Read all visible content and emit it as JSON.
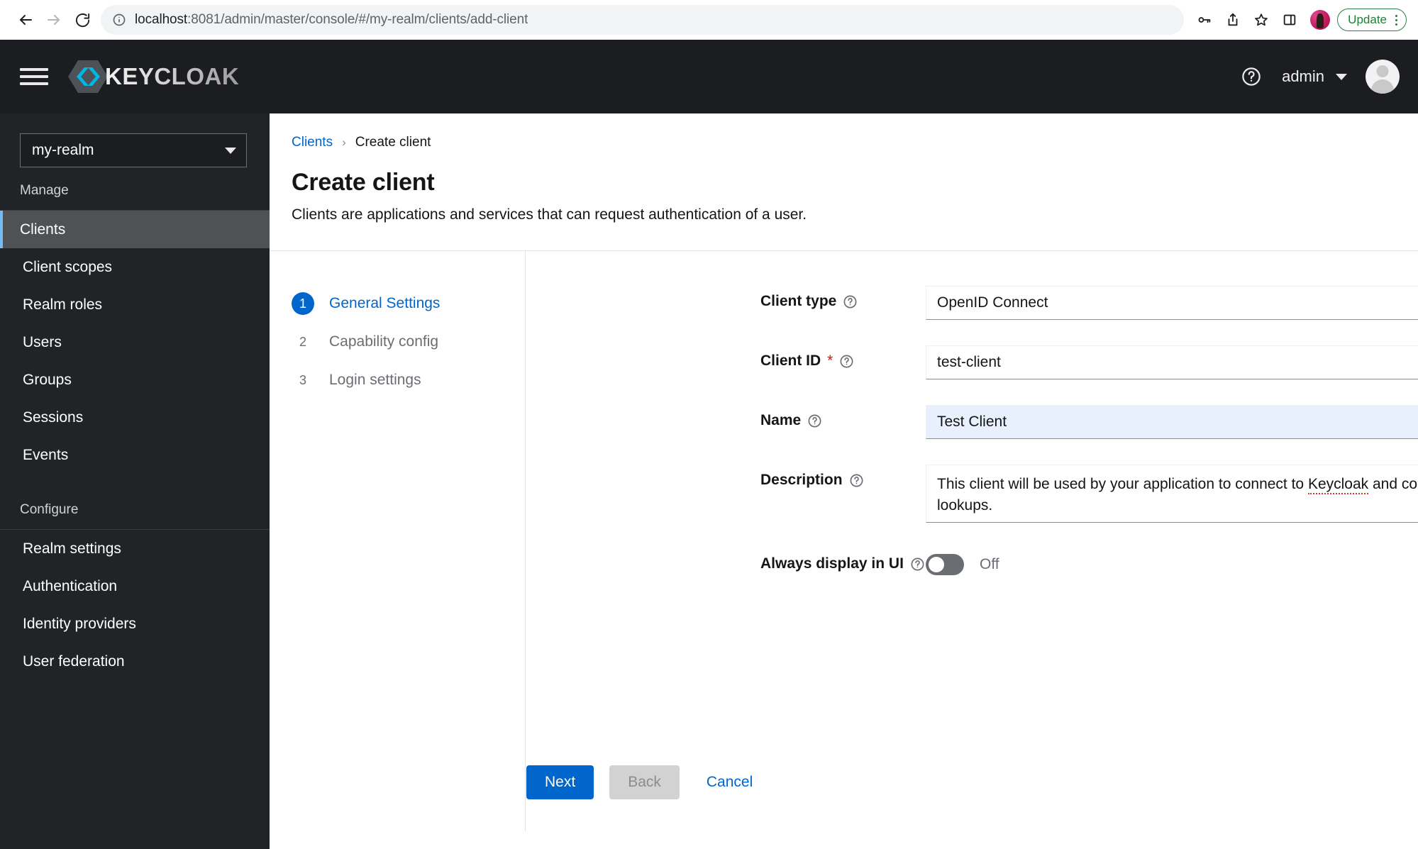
{
  "browser": {
    "back_icon": "back-arrow-icon",
    "forward_icon": "forward-arrow-icon",
    "reload_icon": "reload-icon",
    "info_icon": "site-info-icon",
    "url_host": "localhost",
    "url_path": ":8081/admin/master/console/#/my-realm/clients/add-client",
    "url_full": "localhost:8081/admin/master/console/#/my-realm/clients/add-client",
    "toolbar_icons": [
      "key-icon",
      "share-icon",
      "bookmark-star-icon",
      "side-panel-icon"
    ],
    "profile_avatar": "chrome-profile-avatar",
    "update_label": "Update",
    "menu_icon": "kebab-menu-icon"
  },
  "masthead": {
    "menu_icon": "hamburger-menu-icon",
    "logo_mark": "keycloak-hexagon-logo-icon",
    "logo_text": "KEYCLOAK",
    "help_icon": "help-question-icon",
    "user_name": "admin",
    "user_caret": "chevron-down-icon",
    "avatar": "user-avatar"
  },
  "sidebar": {
    "realm": {
      "value": "my-realm",
      "caret": "chevron-down-icon"
    },
    "sections": [
      {
        "title": "Manage",
        "items": [
          {
            "label": "Clients",
            "active": true
          },
          {
            "label": "Client scopes",
            "active": false
          },
          {
            "label": "Realm roles",
            "active": false
          },
          {
            "label": "Users",
            "active": false
          },
          {
            "label": "Groups",
            "active": false
          },
          {
            "label": "Sessions",
            "active": false
          },
          {
            "label": "Events",
            "active": false
          }
        ]
      },
      {
        "title": "Configure",
        "items": [
          {
            "label": "Realm settings",
            "active": false
          },
          {
            "label": "Authentication",
            "active": false
          },
          {
            "label": "Identity providers",
            "active": false
          },
          {
            "label": "User federation",
            "active": false
          }
        ]
      }
    ]
  },
  "page": {
    "breadcrumb": {
      "parent": "Clients",
      "separator": "›",
      "current": "Create client"
    },
    "title": "Create client",
    "subtitle": "Clients are applications and services that can request authentication of a user."
  },
  "wizard": {
    "steps": [
      {
        "num": "1",
        "label": "General Settings",
        "active": true
      },
      {
        "num": "2",
        "label": "Capability config",
        "active": false
      },
      {
        "num": "3",
        "label": "Login settings",
        "active": false
      }
    ]
  },
  "form": {
    "client_type": {
      "label": "Client type",
      "help_icon": "help-question-icon",
      "value": "OpenID Connect",
      "caret": "chevron-down-icon"
    },
    "client_id": {
      "label": "Client ID",
      "required_marker": "*",
      "help_icon": "help-question-icon",
      "value": "test-client",
      "placeholder": ""
    },
    "name": {
      "label": "Name",
      "help_icon": "help-question-icon",
      "value": "Test Client",
      "placeholder": ""
    },
    "description": {
      "label": "Description",
      "help_icon": "help-question-icon",
      "value_part1": "This client will be used by your application to connect to ",
      "value_misspelled": "Keycloak",
      "value_part2": " and complete authentication lookups.",
      "value": "This client will be used by your application to connect to Keycloak and complete authentication lookups."
    },
    "always_display": {
      "label": "Always display in UI",
      "help_icon": "help-question-icon",
      "state": "Off",
      "checked": false
    }
  },
  "actions": {
    "next": "Next",
    "back": "Back",
    "cancel": "Cancel"
  },
  "colors": {
    "accent_blue": "#0066cc",
    "masthead_bg": "#1b1d21",
    "sidebar_bg": "#212427",
    "active_nav_bg": "#4f5255",
    "active_nav_bar": "#73bcf7",
    "required_red": "#c9190b",
    "filled_field_bg": "#e8f0fe",
    "update_green": "#1e7e34"
  }
}
